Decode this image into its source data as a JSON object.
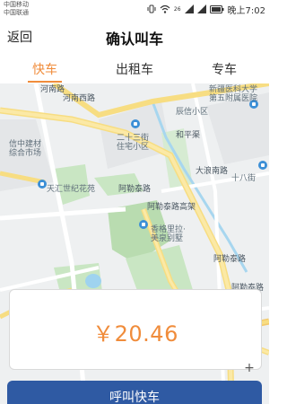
{
  "status_bar": {
    "carrier_1": "中国移动",
    "carrier_2": "中国联通",
    "signal_label": "26",
    "time": "晚上7:02"
  },
  "nav": {
    "back_label": "返回",
    "title": "确认叫车"
  },
  "tabs": [
    {
      "label": "快车",
      "active": true
    },
    {
      "label": "出租车",
      "active": false
    },
    {
      "label": "专车",
      "active": false
    }
  ],
  "map": {
    "labels": {
      "henan_west_road": "河南西路",
      "henan_road": "河南路",
      "xinjiang_hospital_1": "新疆医科大学",
      "xinjiang_hospital_2": "第五附属医院",
      "chenxin_community": "辰信小区",
      "ershisan_jie_1": "二十三街",
      "ershisan_jie_2": "住宅小区",
      "heping_channel": "和平渠",
      "xinzhong_market_1": "信中建材",
      "xinzhong_market_2": "综合市场",
      "shiba_jie": "十八街",
      "dajingnan_road": "大浪南路",
      "tianhui_garden": "天汇世纪花苑",
      "alatai_road": "阿勒泰路",
      "alatai_elevated": "阿勒泰路高架",
      "shangri_la_1": "香格里拉·",
      "shangri_la_2": "美泉别墅",
      "alatai_road_2": "阿勒泰路",
      "alatai_road_3": "阿勒泰路"
    }
  },
  "fare": {
    "amount": "￥20.46"
  },
  "zoom": {
    "plus": "+"
  },
  "call_button": {
    "label": "呼叫快车"
  },
  "colors": {
    "accent": "#f08c3b",
    "primary": "#2f5aa3"
  }
}
